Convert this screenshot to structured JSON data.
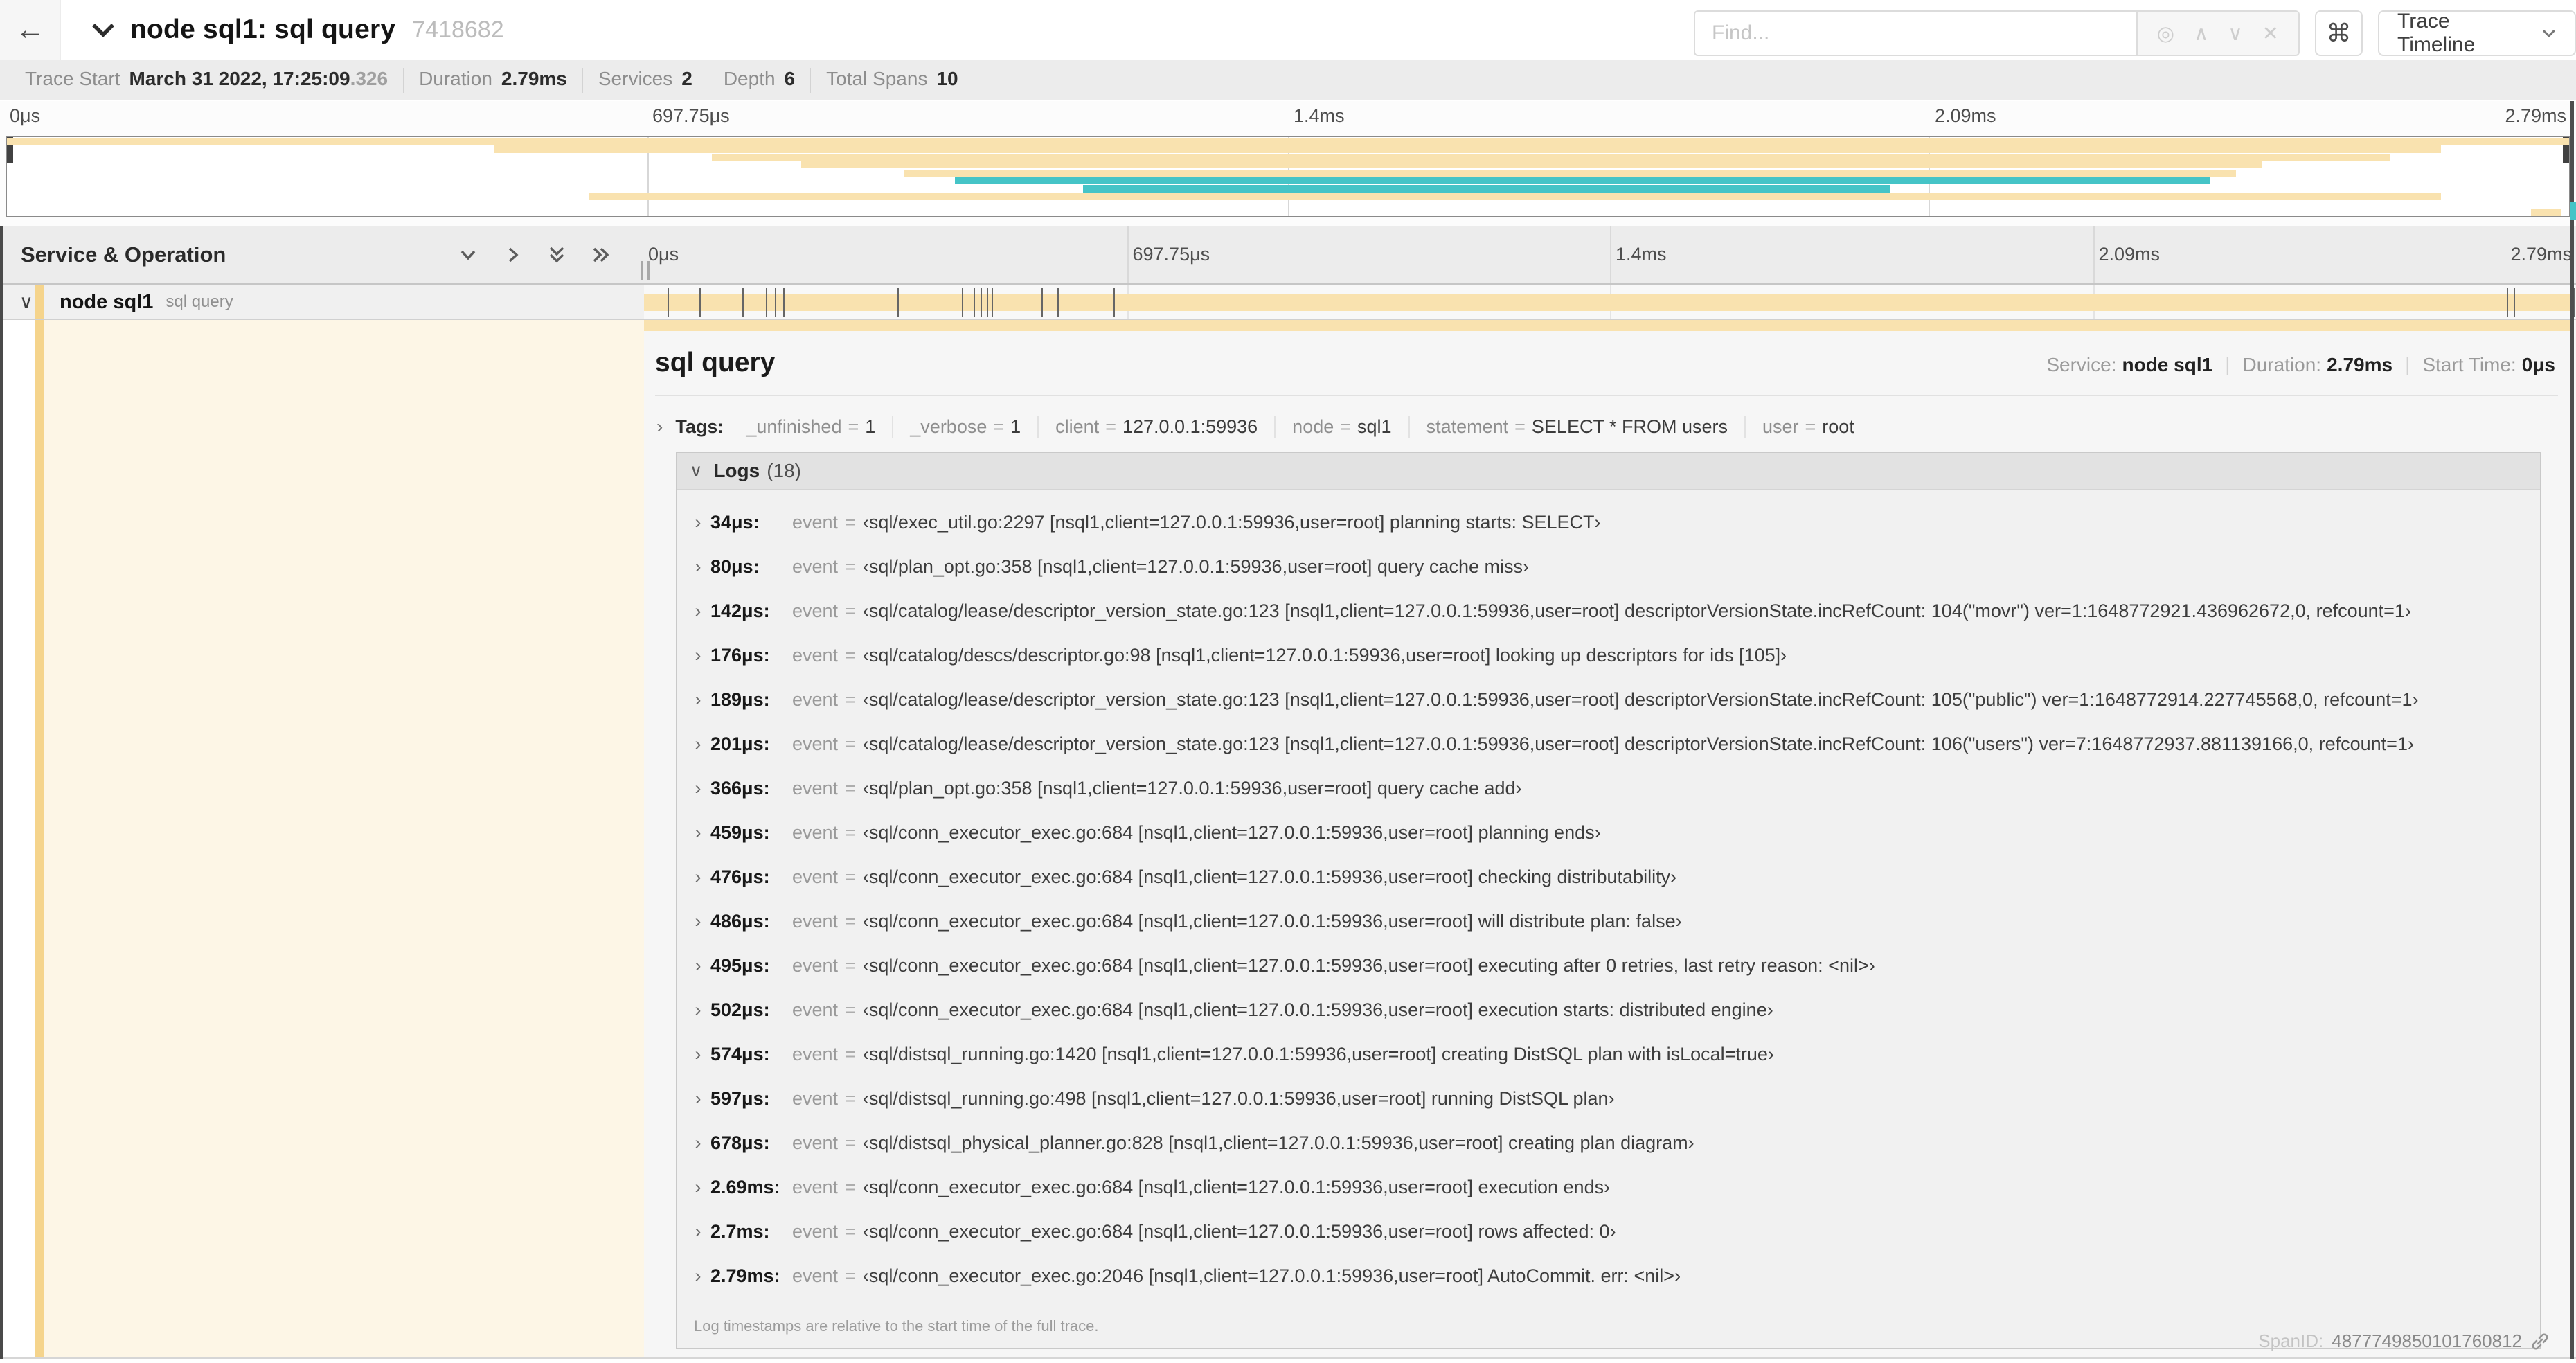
{
  "colors": {
    "tan": "#f9e2af",
    "tan_accent": "#f5d48c",
    "teal": "#45c4c7",
    "cream": "#fdf6e6"
  },
  "header": {
    "back_icon": "←",
    "title": "node sql1: sql query",
    "trace_id": "7418682",
    "find_placeholder": "Find...",
    "find_icons": [
      "◎",
      "∧",
      "∨",
      "✕"
    ],
    "shortcut_icon": "⌘",
    "view_selector": "Trace Timeline"
  },
  "trace_info": {
    "items": [
      {
        "label": "Trace Start",
        "value": "March 31 2022, 17:25:09",
        "suffix": ".326"
      },
      {
        "label": "Duration",
        "value": "2.79ms"
      },
      {
        "label": "Services",
        "value": "2"
      },
      {
        "label": "Depth",
        "value": "6"
      },
      {
        "label": "Total Spans",
        "value": "10"
      }
    ]
  },
  "timeline": {
    "header_label": "Service & Operation",
    "ticks": [
      "0μs",
      "697.75μs",
      "1.4ms",
      "2.09ms",
      "2.79ms"
    ],
    "row": {
      "service": "node sql1",
      "operation": "sql query"
    },
    "total_us": 2790,
    "log_tick_times_us": [
      34,
      80,
      142,
      176,
      189,
      201,
      366,
      459,
      476,
      486,
      495,
      502,
      574,
      597,
      678,
      2690,
      2700,
      2786
    ],
    "minimap_spans": [
      {
        "row": 0,
        "start": 0,
        "end": 100,
        "color": "tan"
      },
      {
        "row": 1,
        "start": 19,
        "end": 95,
        "color": "tan"
      },
      {
        "row": 2,
        "start": 27.5,
        "end": 93,
        "color": "tan"
      },
      {
        "row": 3,
        "start": 31,
        "end": 88,
        "color": "tan"
      },
      {
        "row": 4,
        "start": 35,
        "end": 87,
        "color": "tan"
      },
      {
        "row": 5,
        "start": 37,
        "end": 86,
        "color": "teal"
      },
      {
        "row": 6,
        "start": 42,
        "end": 73.5,
        "color": "teal"
      },
      {
        "row": 7,
        "start": 22.7,
        "end": 95,
        "color": "tan"
      },
      {
        "row": 9,
        "start": 98.5,
        "end": 99.7,
        "color": "tan"
      }
    ]
  },
  "detail": {
    "title": "sql query",
    "service_label": "Service:",
    "service": "node sql1",
    "duration_label": "Duration:",
    "duration": "2.79ms",
    "start_time_label": "Start Time:",
    "start_time": "0μs",
    "tags_label": "Tags:",
    "tags": [
      {
        "key": "_unfinished",
        "value": "1"
      },
      {
        "key": "_verbose",
        "value": "1"
      },
      {
        "key": "client",
        "value": "127.0.0.1:59936"
      },
      {
        "key": "node",
        "value": "sql1"
      },
      {
        "key": "statement",
        "value": "SELECT * FROM users"
      },
      {
        "key": "user",
        "value": "root"
      }
    ],
    "logs_label": "Logs",
    "logs_count": "(18)",
    "logs": [
      {
        "time": "34μs:",
        "field": "event",
        "value": "‹sql/exec_util.go:2297 [nsql1,client=127.0.0.1:59936,user=root] planning starts: SELECT›"
      },
      {
        "time": "80μs:",
        "field": "event",
        "value": "‹sql/plan_opt.go:358 [nsql1,client=127.0.0.1:59936,user=root] query cache miss›"
      },
      {
        "time": "142μs:",
        "field": "event",
        "value": "‹sql/catalog/lease/descriptor_version_state.go:123 [nsql1,client=127.0.0.1:59936,user=root] descriptorVersionState.incRefCount: 104(\"movr\") ver=1:1648772921.436962672,0, refcount=1›"
      },
      {
        "time": "176μs:",
        "field": "event",
        "value": "‹sql/catalog/descs/descriptor.go:98 [nsql1,client=127.0.0.1:59936,user=root] looking up descriptors for ids [105]›"
      },
      {
        "time": "189μs:",
        "field": "event",
        "value": "‹sql/catalog/lease/descriptor_version_state.go:123 [nsql1,client=127.0.0.1:59936,user=root] descriptorVersionState.incRefCount: 105(\"public\") ver=1:1648772914.227745568,0, refcount=1›"
      },
      {
        "time": "201μs:",
        "field": "event",
        "value": "‹sql/catalog/lease/descriptor_version_state.go:123 [nsql1,client=127.0.0.1:59936,user=root] descriptorVersionState.incRefCount: 106(\"users\") ver=7:1648772937.881139166,0, refcount=1›"
      },
      {
        "time": "366μs:",
        "field": "event",
        "value": "‹sql/plan_opt.go:358 [nsql1,client=127.0.0.1:59936,user=root] query cache add›"
      },
      {
        "time": "459μs:",
        "field": "event",
        "value": "‹sql/conn_executor_exec.go:684 [nsql1,client=127.0.0.1:59936,user=root] planning ends›"
      },
      {
        "time": "476μs:",
        "field": "event",
        "value": "‹sql/conn_executor_exec.go:684 [nsql1,client=127.0.0.1:59936,user=root] checking distributability›"
      },
      {
        "time": "486μs:",
        "field": "event",
        "value": "‹sql/conn_executor_exec.go:684 [nsql1,client=127.0.0.1:59936,user=root] will distribute plan: false›"
      },
      {
        "time": "495μs:",
        "field": "event",
        "value": "‹sql/conn_executor_exec.go:684 [nsql1,client=127.0.0.1:59936,user=root] executing after 0 retries, last retry reason: <nil>›"
      },
      {
        "time": "502μs:",
        "field": "event",
        "value": "‹sql/conn_executor_exec.go:684 [nsql1,client=127.0.0.1:59936,user=root] execution starts: distributed engine›"
      },
      {
        "time": "574μs:",
        "field": "event",
        "value": "‹sql/distsql_running.go:1420 [nsql1,client=127.0.0.1:59936,user=root] creating DistSQL plan with isLocal=true›"
      },
      {
        "time": "597μs:",
        "field": "event",
        "value": "‹sql/distsql_running.go:498 [nsql1,client=127.0.0.1:59936,user=root] running DistSQL plan›"
      },
      {
        "time": "678μs:",
        "field": "event",
        "value": "‹sql/distsql_physical_planner.go:828 [nsql1,client=127.0.0.1:59936,user=root] creating plan diagram›"
      },
      {
        "time": "2.69ms:",
        "field": "event",
        "value": "‹sql/conn_executor_exec.go:684 [nsql1,client=127.0.0.1:59936,user=root] execution ends›"
      },
      {
        "time": "2.7ms:",
        "field": "event",
        "value": "‹sql/conn_executor_exec.go:684 [nsql1,client=127.0.0.1:59936,user=root] rows affected: 0›"
      },
      {
        "time": "2.79ms:",
        "field": "event",
        "value": "‹sql/conn_executor_exec.go:2046 [nsql1,client=127.0.0.1:59936,user=root] AutoCommit. err: <nil>›"
      }
    ],
    "logs_note": "Log timestamps are relative to the start time of the full trace.",
    "spanid_label": "SpanID:",
    "spanid_value": "4877749850101760812"
  }
}
